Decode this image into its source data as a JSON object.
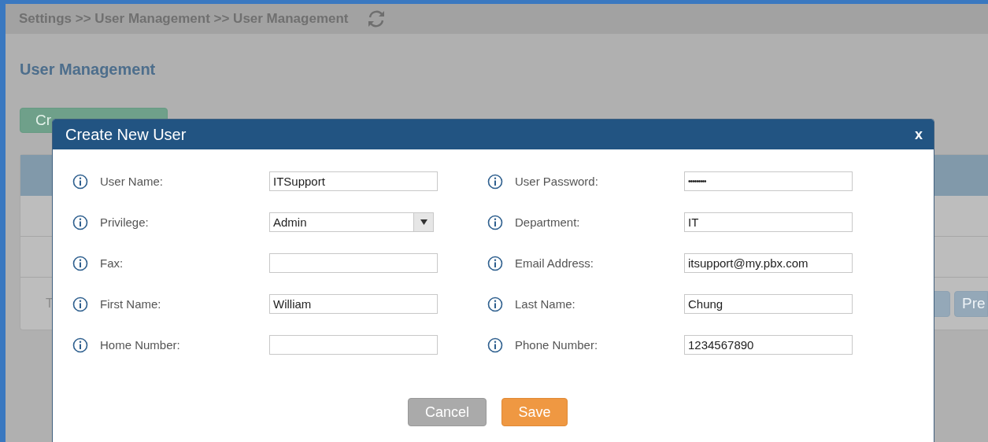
{
  "breadcrumb": {
    "path": "Settings >> User Management >> User Management"
  },
  "page_title": "User Management",
  "create_button": {
    "label": "Cr"
  },
  "table": {
    "footer_text": "T",
    "pagination": [
      {
        "kind": "icon"
      },
      {
        "kind": "text",
        "label": "Pre"
      }
    ]
  },
  "dialog": {
    "title": "Create New User",
    "close": "x",
    "fields": [
      {
        "label": "User Name:",
        "kind": "text",
        "value": "ITSupport"
      },
      {
        "label": "User Password:",
        "kind": "password",
        "value": "•••••••••"
      },
      {
        "label": "Privilege:",
        "kind": "select",
        "value": "Admin"
      },
      {
        "label": "Department:",
        "kind": "text",
        "value": "IT"
      },
      {
        "label": "Fax:",
        "kind": "text"
      },
      {
        "label": "Email Address:",
        "kind": "text",
        "value": "itsupport@my.pbx.com"
      },
      {
        "label": "First Name:",
        "kind": "text",
        "value": "William"
      },
      {
        "label": "Last Name:",
        "kind": "text",
        "value": "Chung"
      },
      {
        "label": "Home Number:",
        "kind": "text"
      },
      {
        "label": "Phone Number:",
        "kind": "text",
        "value": "1234567890"
      }
    ],
    "buttons": [
      {
        "label": "Cancel",
        "kind": "secondary"
      },
      {
        "label": "Save",
        "kind": "primary"
      }
    ]
  }
}
